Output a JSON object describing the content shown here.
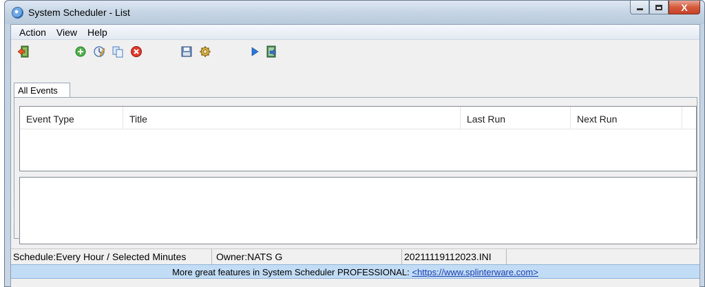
{
  "window": {
    "title": "System Scheduler - List",
    "controls": {
      "close_glyph": "X"
    }
  },
  "menu": {
    "items": [
      {
        "label": "Action"
      },
      {
        "label": "View"
      },
      {
        "label": "Help"
      }
    ]
  },
  "toolbar": {
    "icons": [
      {
        "name": "exit-icon"
      },
      {
        "name": "add-event-icon"
      },
      {
        "name": "edit-event-icon"
      },
      {
        "name": "copy-event-icon"
      },
      {
        "name": "delete-event-icon"
      },
      {
        "name": "save-icon"
      },
      {
        "name": "settings-icon"
      },
      {
        "name": "run-icon"
      },
      {
        "name": "log-icon"
      }
    ]
  },
  "tabs": [
    {
      "label": "All Events"
    }
  ],
  "list": {
    "columns": [
      "Event Type",
      "Title",
      "Last Run",
      "Next Run"
    ],
    "rows": []
  },
  "status": {
    "schedule": "Schedule:Every Hour / Selected Minutes",
    "owner": "Owner:NATS G",
    "file": "20211119112023.INI"
  },
  "promo": {
    "text": "More great features in System Scheduler PROFESSIONAL: ",
    "link": "<https://www.splinterware.com>"
  },
  "colors": {
    "promo_bg": "#c2dcf5",
    "close_button": "#c7422a",
    "link": "#1a3fb0"
  }
}
